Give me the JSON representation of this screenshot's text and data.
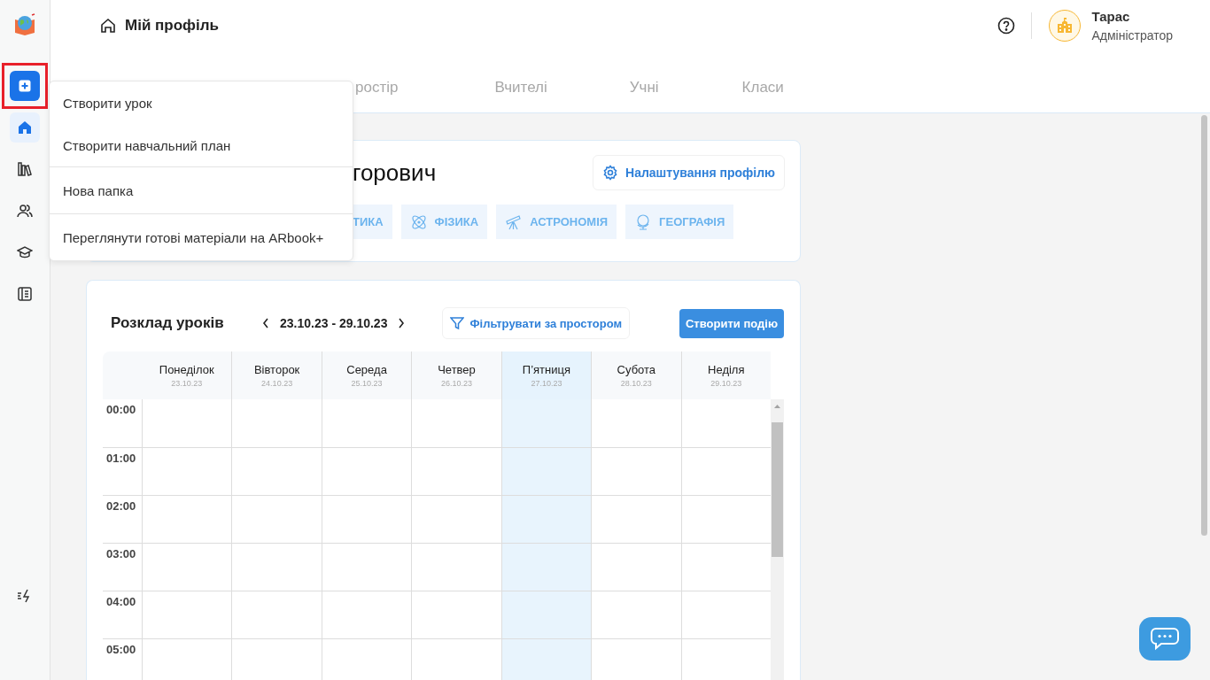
{
  "sidebar": {
    "create_button": {
      "highlighted": true
    },
    "items": [
      {
        "kind": "home",
        "selected": true
      },
      {
        "kind": "library",
        "selected": false
      },
      {
        "kind": "people",
        "selected": false
      },
      {
        "kind": "school",
        "selected": false
      },
      {
        "kind": "notebook",
        "selected": false
      }
    ],
    "bottom": {
      "kind": "bolt"
    }
  },
  "header": {
    "title": "Мій профіль",
    "user": {
      "name": "Тарас",
      "role": "Адміністратор"
    }
  },
  "menu": {
    "sections": [
      [
        "Створити урок",
        "Створити навчальний план"
      ],
      [
        "Нова папка"
      ],
      [
        "Переглянути готові матеріали на ARbook+"
      ]
    ]
  },
  "tabs": [
    {
      "label": "ростір"
    },
    {
      "label": "Вчителі"
    },
    {
      "label": "Учні"
    },
    {
      "label": "Класи"
    }
  ],
  "profile": {
    "name": "горович",
    "settings_button": "Налаштування профілю",
    "tags": [
      {
        "label": "ТИКА",
        "kind": "cut"
      },
      {
        "label": "ФІЗИКА",
        "kind": "atom"
      },
      {
        "label": "АСТРОНОМІЯ",
        "kind": "telescope"
      },
      {
        "label": "ГЕОГРАФІЯ",
        "kind": "globe"
      }
    ]
  },
  "schedule": {
    "title": "Розклад уроків",
    "range": "23.10.23 - 29.10.23",
    "filter_button": "Фільтрувати за простором",
    "create_button": "Створити подію",
    "days": [
      {
        "name": "Понеділок",
        "date": "23.10.23",
        "selected": false
      },
      {
        "name": "Вівторок",
        "date": "24.10.23",
        "selected": false
      },
      {
        "name": "Середа",
        "date": "25.10.23",
        "selected": false
      },
      {
        "name": "Четвер",
        "date": "26.10.23",
        "selected": false
      },
      {
        "name": "П’ятниця",
        "date": "27.10.23",
        "selected": true
      },
      {
        "name": "Субота",
        "date": "28.10.23",
        "selected": false
      },
      {
        "name": "Неділя",
        "date": "29.10.23",
        "selected": false
      }
    ],
    "hours": [
      "00:00",
      "01:00",
      "02:00",
      "03:00",
      "04:00",
      "05:00"
    ]
  }
}
